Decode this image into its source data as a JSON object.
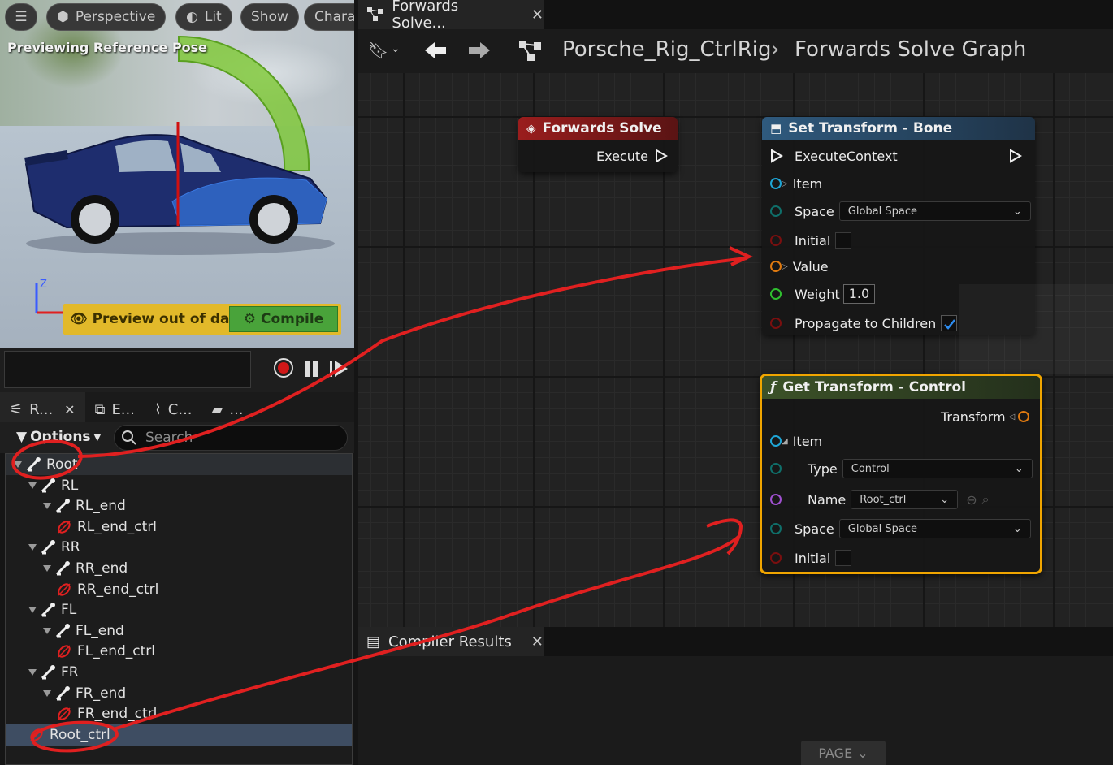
{
  "viewport": {
    "buttons": [
      "Perspective",
      "Lit",
      "Show",
      "Chara"
    ],
    "preview_label": "Previewing Reference Pose",
    "preview_warning": "Preview out of date",
    "compile_label": "Compile"
  },
  "left_tabs": [
    {
      "label": "R...",
      "closable": true
    },
    {
      "label": "E...",
      "closable": false
    },
    {
      "label": "C...",
      "closable": false
    },
    {
      "label": "...",
      "closable": false
    }
  ],
  "options_label": "Options",
  "search": {
    "placeholder": "Search",
    "value": ""
  },
  "tree": {
    "rows": [
      {
        "label": "Root",
        "kind": "bone",
        "depth": 0
      },
      {
        "label": "RL",
        "kind": "bone",
        "depth": 1
      },
      {
        "label": "RL_end",
        "kind": "bone",
        "depth": 2
      },
      {
        "label": "RL_end_ctrl",
        "kind": "control",
        "depth": 3
      },
      {
        "label": "RR",
        "kind": "bone",
        "depth": 1
      },
      {
        "label": "RR_end",
        "kind": "bone",
        "depth": 2
      },
      {
        "label": "RR_end_ctrl",
        "kind": "control",
        "depth": 3
      },
      {
        "label": "FL",
        "kind": "bone",
        "depth": 1
      },
      {
        "label": "FL_end",
        "kind": "bone",
        "depth": 2
      },
      {
        "label": "FL_end_ctrl",
        "kind": "control",
        "depth": 3
      },
      {
        "label": "FR",
        "kind": "bone",
        "depth": 1
      },
      {
        "label": "FR_end",
        "kind": "bone",
        "depth": 2
      },
      {
        "label": "FR_end_ctrl",
        "kind": "control",
        "depth": 3
      },
      {
        "label": "Root_ctrl",
        "kind": "control",
        "depth": 1
      }
    ]
  },
  "graph_tab": {
    "label": "Forwards Solve..."
  },
  "breadcrumb": {
    "asset": "Porsche_Rig_CtrlRig",
    "graph": "Forwards Solve Graph"
  },
  "nodes": {
    "forwards_solve": {
      "title": "Forwards Solve",
      "execute": "Execute"
    },
    "set_transform": {
      "title": "Set Transform - Bone",
      "execute_context": "ExecuteContext",
      "item": "Item",
      "space": "Space",
      "space_value": "Global Space",
      "initial": "Initial",
      "value": "Value",
      "weight": "Weight",
      "weight_value": "1.0",
      "propagate": "Propagate to Children"
    },
    "get_transform": {
      "title": "Get Transform - Control",
      "transform": "Transform",
      "item": "Item",
      "type": "Type",
      "type_value": "Control",
      "name": "Name",
      "name_value": "Root_ctrl",
      "space": "Space",
      "space_value": "Global Space",
      "initial": "Initial"
    }
  },
  "compiler": {
    "tab_label": "Compiler Results",
    "page_label": "PAGE"
  },
  "colors": {
    "forwards_solve_header": "#8b1c1c",
    "set_transform_header": "#2c4a63",
    "get_transform_header": "#3b4a2c",
    "selection_outline": "#f0a500",
    "annotation": "#e02020"
  }
}
